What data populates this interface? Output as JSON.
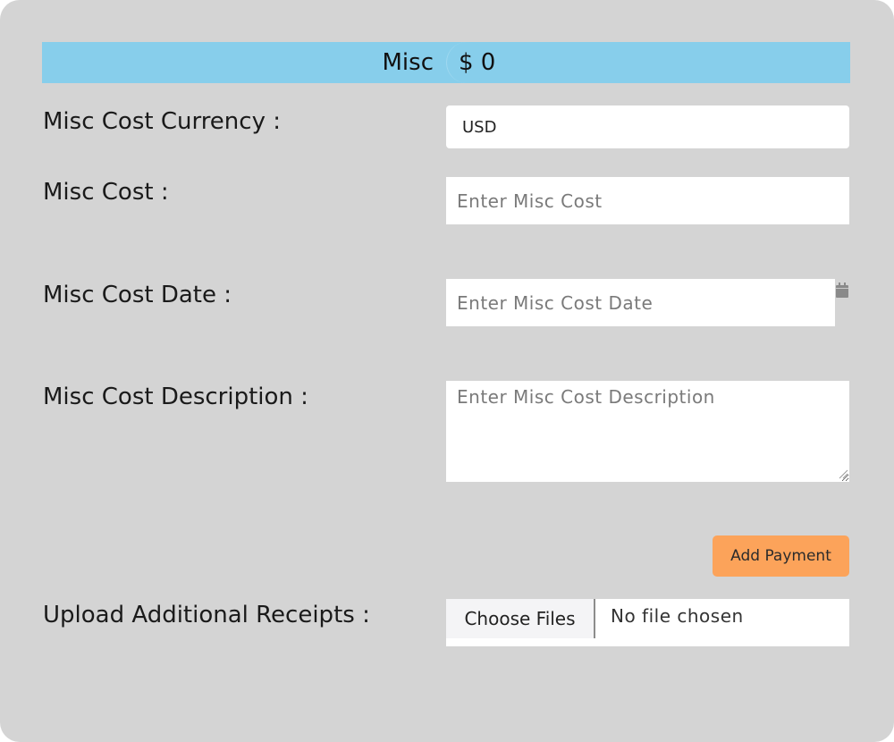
{
  "header": {
    "title": "Misc",
    "amount": "$ 0",
    "color": "#87ceeb"
  },
  "form": {
    "currency_label": "Misc Cost Currency :",
    "currency_value": "USD",
    "cost_label": "Misc Cost :",
    "cost_placeholder": "Enter Misc Cost",
    "date_label": "Misc Cost Date :",
    "date_placeholder": "Enter Misc Cost Date",
    "date_icon": "calendar-icon",
    "description_label": "Misc Cost Description :",
    "description_placeholder": "Enter Misc Cost Description",
    "add_payment_label": "Add Payment",
    "add_payment_color": "#fca35a",
    "upload_label": "Upload Additional Receipts :",
    "upload_button_label": "Choose Files",
    "upload_status": "No file chosen"
  },
  "colors": {
    "background": "#d4d4d4"
  }
}
